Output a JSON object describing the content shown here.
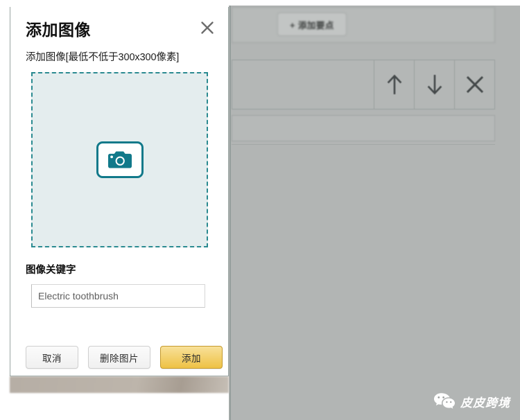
{
  "dialog": {
    "title": "添加图像",
    "close_icon": "close-icon",
    "subtitle": "添加图像[最低不低于300x300像素]",
    "dropzone": {
      "icon": "camera-icon",
      "hint": ""
    },
    "keyword_field": {
      "label": "图像关键字",
      "value": "Electric toothbrush",
      "placeholder": "Electric toothbrush"
    },
    "buttons": {
      "cancel": "取消",
      "delete": "删除图片",
      "add": "添加"
    }
  },
  "background": {
    "add_point_button": "+ 添加要点",
    "toolbar_icons": [
      {
        "name": "arrow-up-icon",
        "glyph": "↑"
      },
      {
        "name": "arrow-down-icon",
        "glyph": "↓"
      },
      {
        "name": "close-icon",
        "glyph": "✕"
      }
    ]
  },
  "watermark": {
    "icon": "wechat-icon",
    "text": "皮皮跨境"
  },
  "colors": {
    "accent_teal": "#11798a",
    "dropzone_fill": "#e4edee",
    "primary_button": "#eec245",
    "panel_gray": "#b2b5b4"
  }
}
